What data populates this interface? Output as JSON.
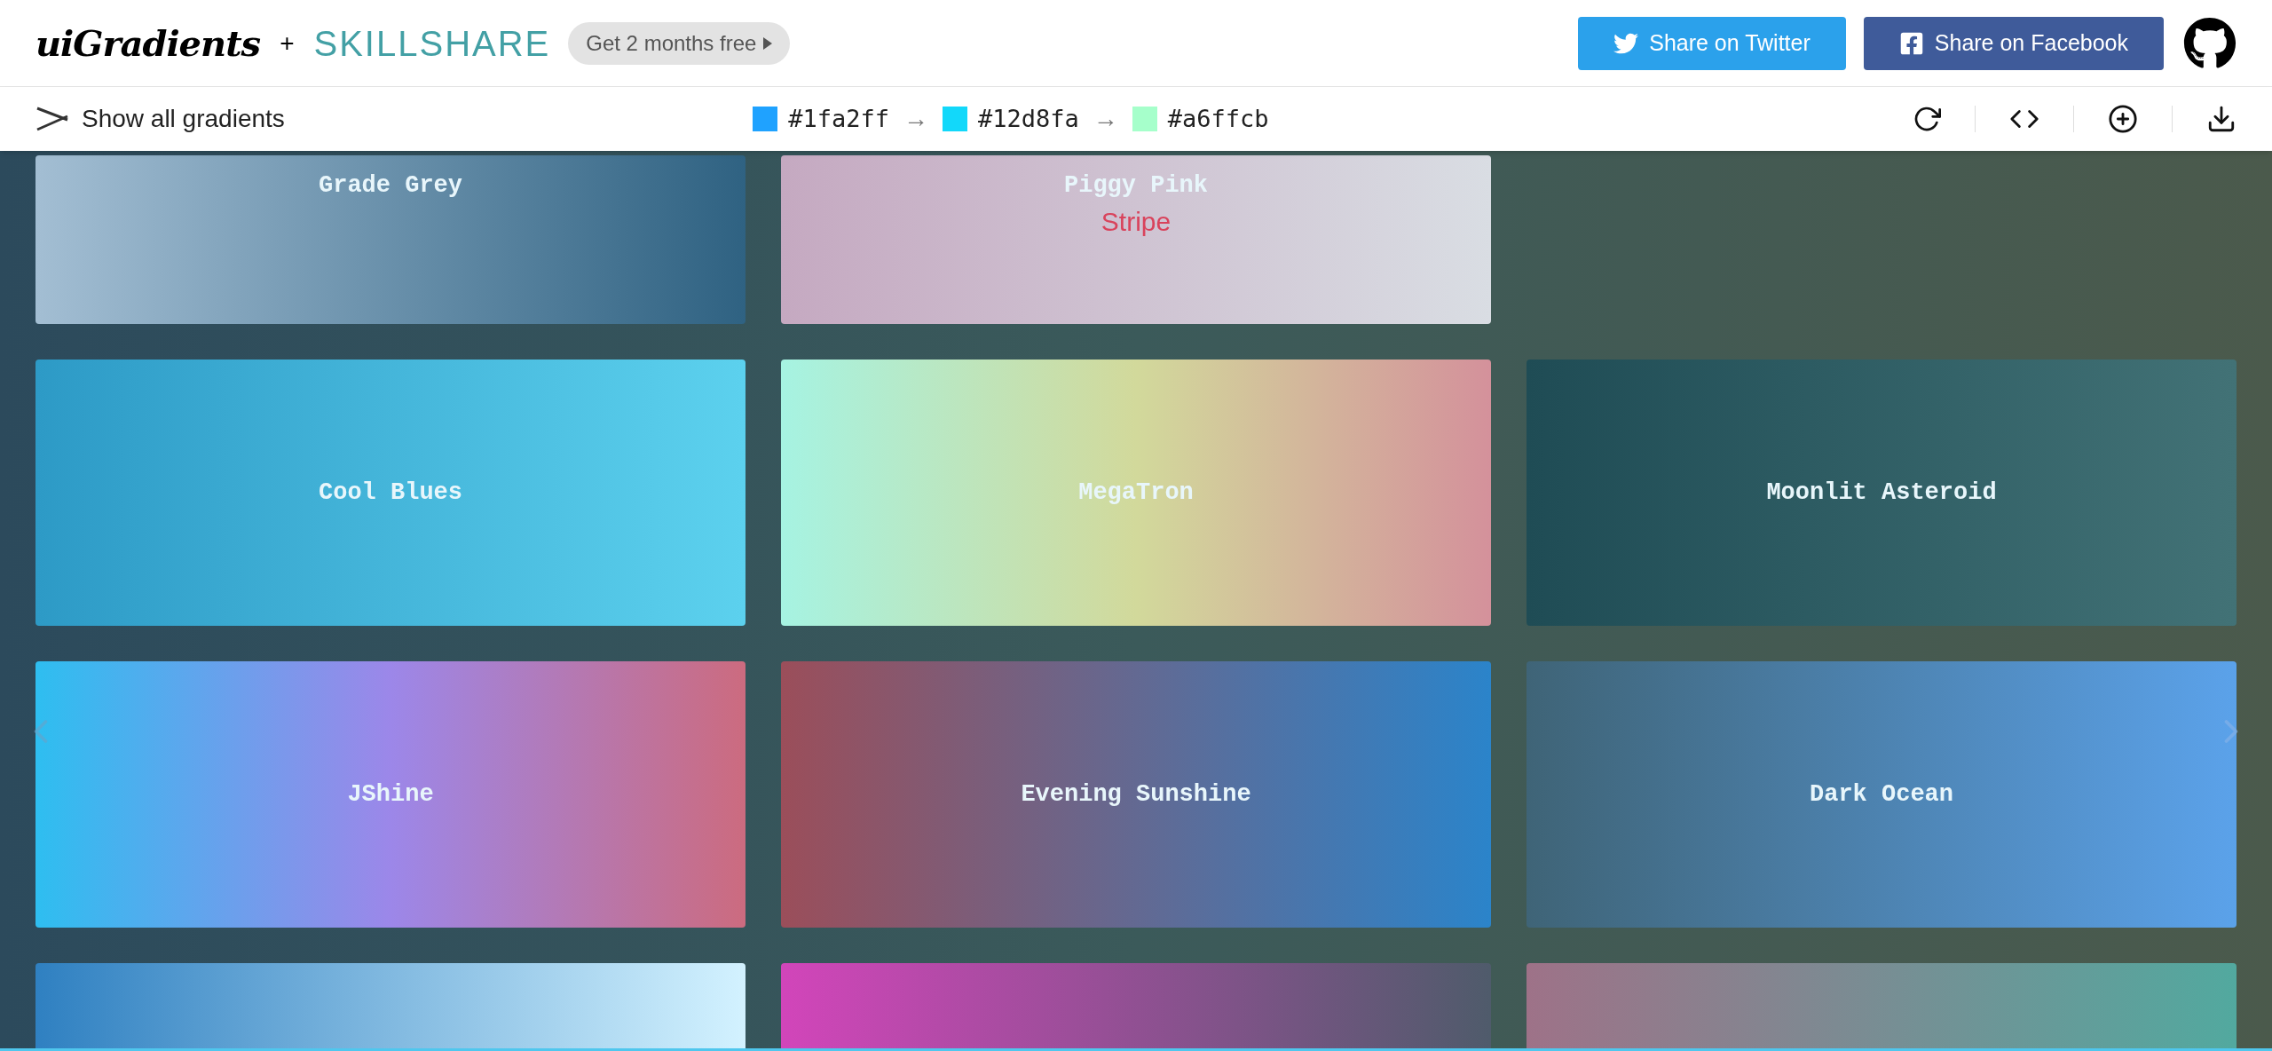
{
  "header": {
    "logo": "uiGradients",
    "plus": "+",
    "partner": "SKILLSHARE",
    "promo": "Get 2 months free",
    "share_buttons": [
      {
        "kind": "twitter",
        "label": "Share on Twitter"
      },
      {
        "kind": "facebook",
        "label": "Share on Facebook"
      }
    ]
  },
  "toolbar": {
    "show_all": "Show all gradients",
    "colors": [
      {
        "hex": "#1fa2ff",
        "color": "#1fa2ff"
      },
      {
        "hex": "#12d8fa",
        "color": "#12d8fa"
      },
      {
        "hex": "#a6ffcb",
        "color": "#a6ffcb"
      }
    ],
    "arrow": "→"
  },
  "cards": [
    {
      "name": "Grade Grey",
      "stops": [
        {
          "color": "#a3bed3"
        },
        {
          "color": "#2f6282"
        }
      ]
    },
    {
      "name": "Piggy Pink",
      "overlay": "Stripe",
      "stops": [
        {
          "color": "#c5a9c1"
        },
        {
          "color": "#d9dde3"
        }
      ]
    },
    {
      "name": "Cool Blues",
      "stops": [
        {
          "color": "#2d9ac6"
        },
        {
          "color": "#5cd1ee"
        }
      ]
    },
    {
      "name": "MegaTron",
      "stops": [
        {
          "color": "#a6f3e2"
        },
        {
          "color": "#d2d99b"
        },
        {
          "color": "#d4919b"
        }
      ]
    },
    {
      "name": "Moonlit Asteroid",
      "stops": [
        {
          "color": "#1f4c55"
        },
        {
          "color": "#427276"
        }
      ]
    },
    {
      "name": "JShine",
      "stops": [
        {
          "color": "#2ebef0"
        },
        {
          "color": "#9c87e9"
        },
        {
          "color": "#cc6b7f"
        }
      ]
    },
    {
      "name": "Evening Sunshine",
      "stops": [
        {
          "color": "#9b4e5a"
        },
        {
          "color": "#2b84ca"
        }
      ]
    },
    {
      "name": "Dark Ocean",
      "stops": [
        {
          "color": "#3f6477"
        },
        {
          "color": "#5ba2ea"
        }
      ]
    },
    {
      "stops": [
        {
          "color": "#2f80c1"
        },
        {
          "color": "#d3f2ff"
        }
      ]
    },
    {
      "stops": [
        {
          "color": "#d245ba"
        },
        {
          "color": "#4f5b6b"
        }
      ]
    },
    {
      "stops": [
        {
          "color": "#9e7288"
        },
        {
          "color": "#52a99f"
        }
      ]
    }
  ]
}
